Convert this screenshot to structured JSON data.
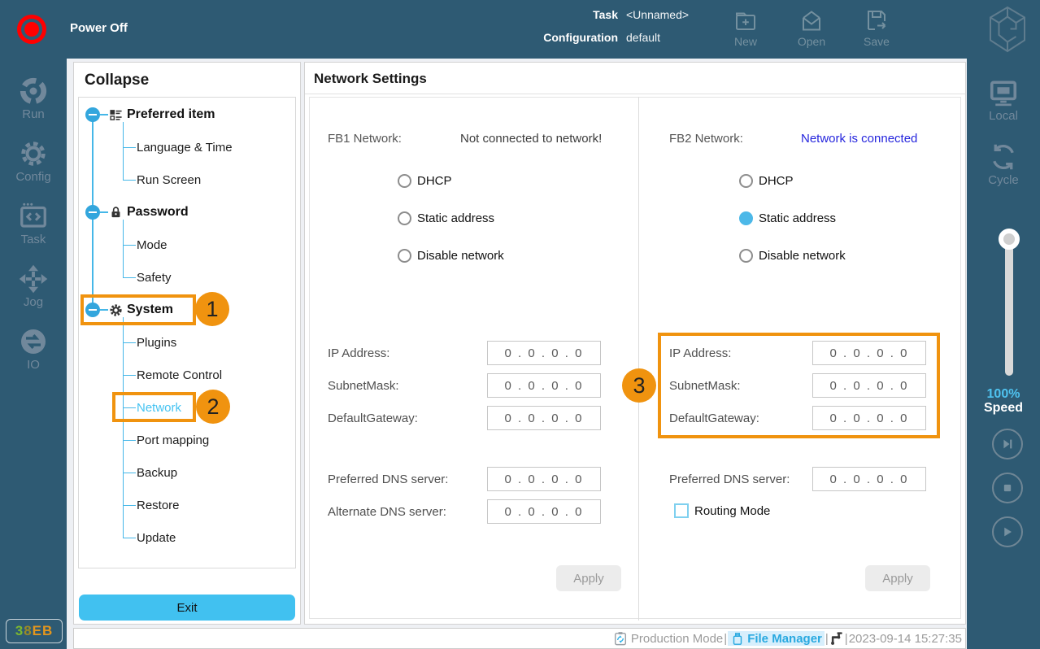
{
  "topbar": {
    "power_label": "Power Off",
    "task_label": "Task",
    "task_value": "<Unnamed>",
    "configuration_label": "Configuration",
    "configuration_value": "default",
    "actions": [
      {
        "label": "New"
      },
      {
        "label": "Open"
      },
      {
        "label": "Save"
      }
    ]
  },
  "left_nav": {
    "items": [
      {
        "label": "Run"
      },
      {
        "label": "Config"
      },
      {
        "label": "Task"
      },
      {
        "label": "Jog"
      },
      {
        "label": "IO"
      }
    ],
    "badge": {
      "part1": "3",
      "part2": "8",
      "part3": "EB"
    }
  },
  "tree": {
    "header": "Collapse",
    "exit_label": "Exit",
    "groups": [
      {
        "label": "Preferred item",
        "icon": "list-icon",
        "children": [
          "Language & Time",
          "Run Screen"
        ]
      },
      {
        "label": "Password",
        "icon": "lock-icon",
        "children": [
          "Mode",
          "Safety"
        ]
      },
      {
        "label": "System",
        "icon": "gear-icon",
        "selected_child": "Network",
        "children": [
          "Plugins",
          "Remote Control",
          "Network",
          "Port mapping",
          "Backup",
          "Restore",
          "Update"
        ]
      }
    ]
  },
  "annotations": {
    "n1": "1",
    "n2": "2",
    "n3": "3"
  },
  "main": {
    "title": "Network Settings",
    "panels": [
      {
        "name": "FB1",
        "label": "FB1 Network:",
        "status": "Not connected to network!",
        "radios": [
          {
            "label": "DHCP",
            "checked": false
          },
          {
            "label": "Static address",
            "checked": false
          },
          {
            "label": "Disable network",
            "checked": false
          }
        ],
        "fields": [
          {
            "label": "IP Address:",
            "value": "0 . 0 . 0 . 0"
          },
          {
            "label": "SubnetMask:",
            "value": "0 . 0 . 0 . 0"
          },
          {
            "label": "DefaultGateway:",
            "value": "0 . 0 . 0 . 0"
          }
        ],
        "dns_fields": [
          {
            "label": "Preferred DNS server:",
            "value": "0 . 0 . 0 . 0"
          },
          {
            "label": "Alternate DNS server:",
            "value": "0 . 0 . 0 . 0"
          }
        ],
        "apply_label": "Apply"
      },
      {
        "name": "FB2",
        "label": "FB2 Network:",
        "status": "Network is connected",
        "radios": [
          {
            "label": "DHCP",
            "checked": false
          },
          {
            "label": "Static address",
            "checked": true
          },
          {
            "label": "Disable network",
            "checked": false
          }
        ],
        "fields": [
          {
            "label": "IP Address:",
            "value": "0 . 0 . 0 . 0"
          },
          {
            "label": "SubnetMask:",
            "value": "0 . 0 . 0 . 0"
          },
          {
            "label": "DefaultGateway:",
            "value": "0 . 0 . 0 . 0"
          }
        ],
        "dns_fields": [
          {
            "label": "Preferred DNS server:",
            "value": "0 . 0 . 0 . 0"
          }
        ],
        "routing_label": "Routing Mode",
        "apply_label": "Apply"
      }
    ]
  },
  "right_nav": {
    "local_label": "Local",
    "cycle_label": "Cycle",
    "speed_value": "100%",
    "speed_label": "Speed"
  },
  "statusbar": {
    "separator": "|",
    "production_label": "Production Mode",
    "file_manager_label": "File Manager",
    "timestamp": "2023-09-14 15:27:35"
  },
  "colors": {
    "topbar_bg": "#2e5a73",
    "accent_blue": "#45b7e8",
    "selected_cyan": "#45c3f2",
    "annotation_orange": "#f0930f",
    "exit_button_blue": "#41c1f0",
    "connected_link_blue": "#2525dd",
    "power_red": "#ff0000"
  }
}
